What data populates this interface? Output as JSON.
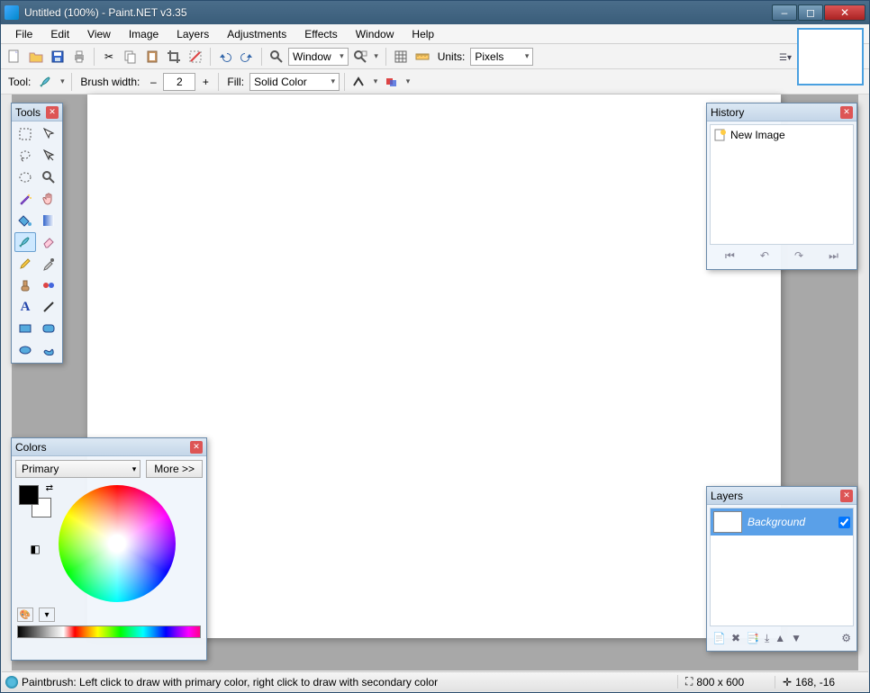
{
  "title": "Untitled (100%) - Paint.NET v3.35",
  "menu": [
    "File",
    "Edit",
    "View",
    "Image",
    "Layers",
    "Adjustments",
    "Effects",
    "Window",
    "Help"
  ],
  "toolbar1": {
    "window_label": "Window",
    "units_label": "Units:",
    "units_value": "Pixels"
  },
  "toolbar2": {
    "tool_label": "Tool:",
    "brush_label": "Brush width:",
    "brush_value": "2",
    "fill_label": "Fill:",
    "fill_value": "Solid Color"
  },
  "tools_panel": {
    "title": "Tools"
  },
  "history_panel": {
    "title": "History",
    "items": [
      "New Image"
    ]
  },
  "layers_panel": {
    "title": "Layers",
    "rows": [
      {
        "name": "Background",
        "visible": true
      }
    ]
  },
  "colors_panel": {
    "title": "Colors",
    "mode": "Primary",
    "more": "More >>"
  },
  "status": {
    "hint": "Paintbrush: Left click to draw with primary color, right click to draw with secondary color",
    "size": "800 x 600",
    "pos": "168, -16"
  }
}
